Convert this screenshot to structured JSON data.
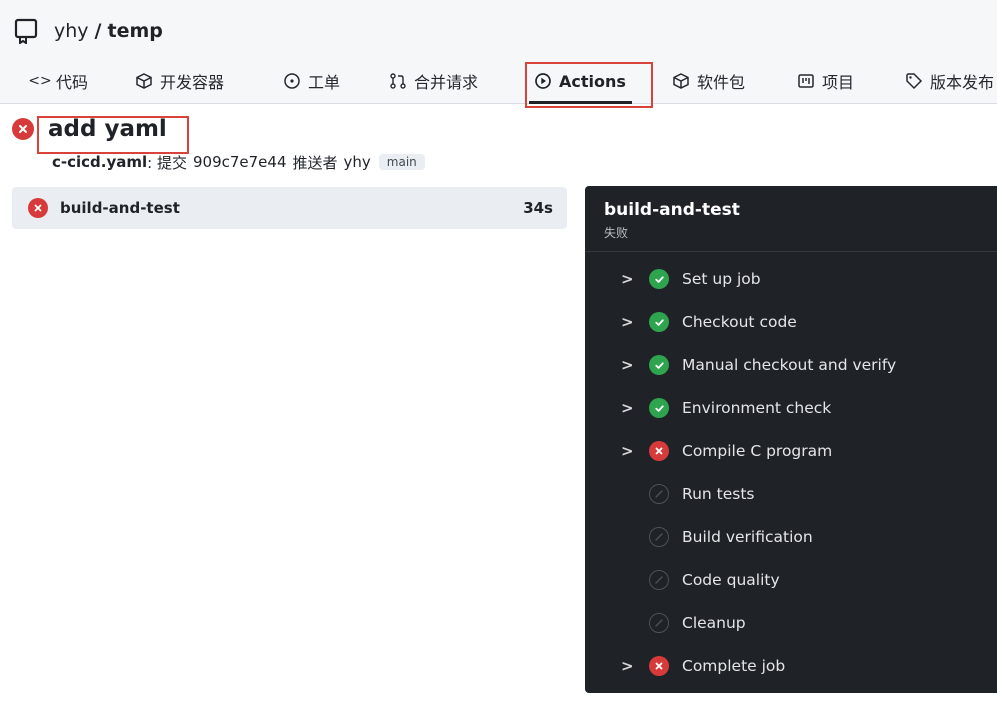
{
  "repo": {
    "owner": "yhy",
    "separator": "/",
    "name": "temp"
  },
  "tabs": [
    {
      "label": "代码",
      "icon": "code-icon"
    },
    {
      "label": "开发容器",
      "icon": "package-box-icon"
    },
    {
      "label": "工单",
      "icon": "issue-circle-icon"
    },
    {
      "label": "合并请求",
      "icon": "pull-request-icon"
    },
    {
      "label": "Actions",
      "icon": "play-circle-icon",
      "active": true
    },
    {
      "label": "软件包",
      "icon": "package-icon"
    },
    {
      "label": "项目",
      "icon": "project-board-icon"
    },
    {
      "label": "版本发布",
      "icon": "tag-icon"
    }
  ],
  "run": {
    "title": "add yaml",
    "status": "failure",
    "workflow_file": "c-cicd.yaml",
    "commit_prefix": ": 提交",
    "commit_sha": "909c7e7e44",
    "pushed_by_label": "推送者",
    "pusher": "yhy",
    "branch": "main"
  },
  "jobs": [
    {
      "name": "build-and-test",
      "duration": "34s",
      "status": "failure"
    }
  ],
  "job_detail": {
    "name": "build-and-test",
    "status_text": "失败",
    "steps": [
      {
        "label": "Set up job",
        "status": "success",
        "expandable": true
      },
      {
        "label": "Checkout code",
        "status": "success",
        "expandable": true
      },
      {
        "label": "Manual checkout and verify",
        "status": "success",
        "expandable": true
      },
      {
        "label": "Environment check",
        "status": "success",
        "expandable": true
      },
      {
        "label": "Compile C program",
        "status": "failure",
        "expandable": true
      },
      {
        "label": "Run tests",
        "status": "skipped",
        "expandable": false
      },
      {
        "label": "Build verification",
        "status": "skipped",
        "expandable": false
      },
      {
        "label": "Code quality",
        "status": "skipped",
        "expandable": false
      },
      {
        "label": "Cleanup",
        "status": "skipped",
        "expandable": false
      },
      {
        "label": "Complete job",
        "status": "failure",
        "expandable": true
      }
    ]
  },
  "colors": {
    "success": "#2ea44f",
    "failure": "#d73a3a",
    "highlight": "#d9443a",
    "panel_bg": "#1f2327"
  }
}
